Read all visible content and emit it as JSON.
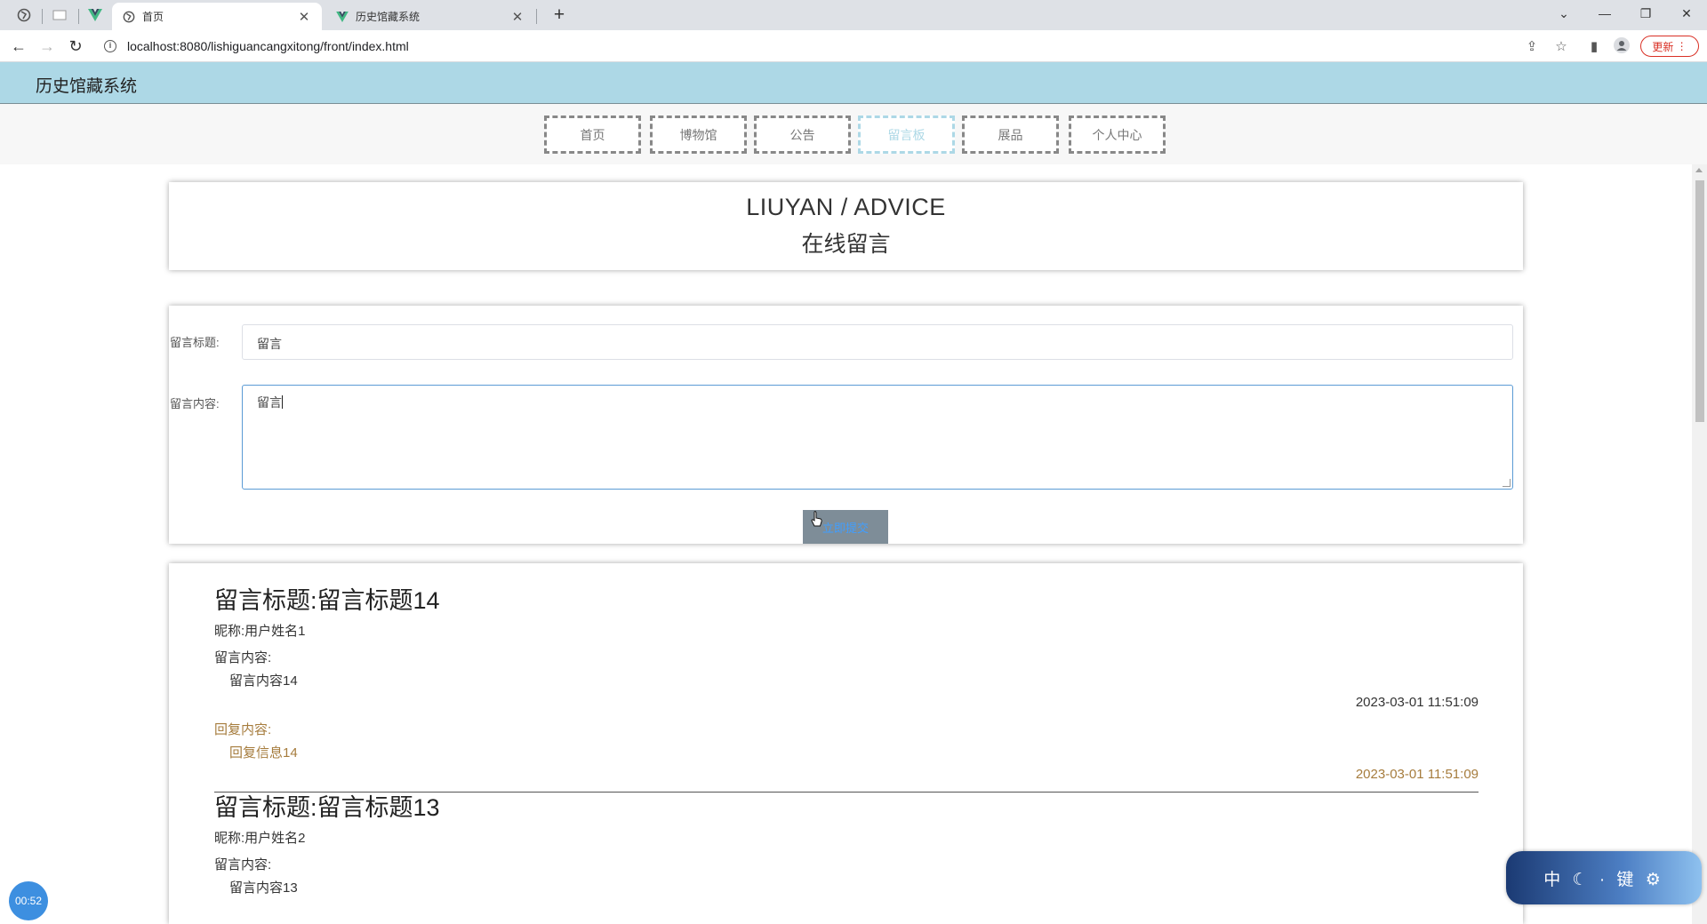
{
  "browser": {
    "tabs": [
      {
        "title": "首页",
        "active": true
      },
      {
        "title": "历史馆藏系统",
        "active": false
      }
    ],
    "url": "localhost:8080/lishiguancangxitong/front/index.html",
    "update_label": "更新"
  },
  "site": {
    "title": "历史馆藏系统",
    "menu": [
      {
        "label": "首页",
        "active": false
      },
      {
        "label": "博物馆",
        "active": false
      },
      {
        "label": "公告",
        "active": false
      },
      {
        "label": "留言板",
        "active": true
      },
      {
        "label": "展品",
        "active": false
      },
      {
        "label": "个人中心",
        "active": false
      }
    ]
  },
  "heading": {
    "en": "LIUYAN / ADVICE",
    "cn": "在线留言"
  },
  "form": {
    "title_label": "留言标题:",
    "title_value": "留言",
    "content_label": "留言内容:",
    "content_value": "留言",
    "submit_label": "立即提交"
  },
  "messages": [
    {
      "title": "留言标题:留言标题14",
      "nickname": "昵称:用户姓名1",
      "content_label": "留言内容:",
      "content": "留言内容14",
      "time": "2023-03-01 11:51:09",
      "reply_label": "回复内容:",
      "reply": "回复信息14",
      "reply_time": "2023-03-01 11:51:09"
    },
    {
      "title": "留言标题:留言标题13",
      "nickname": "昵称:用户姓名2",
      "content_label": "留言内容:",
      "content": "留言内容13"
    }
  ],
  "overlay": {
    "timer": "00:52",
    "widget_text": "中 ☾ · 键 ⚙"
  },
  "colors": {
    "header_bg": "#add8e6",
    "active_menu": "#add8e6",
    "reply_text": "#a67c3d",
    "focus_border": "#5b9bd5"
  }
}
